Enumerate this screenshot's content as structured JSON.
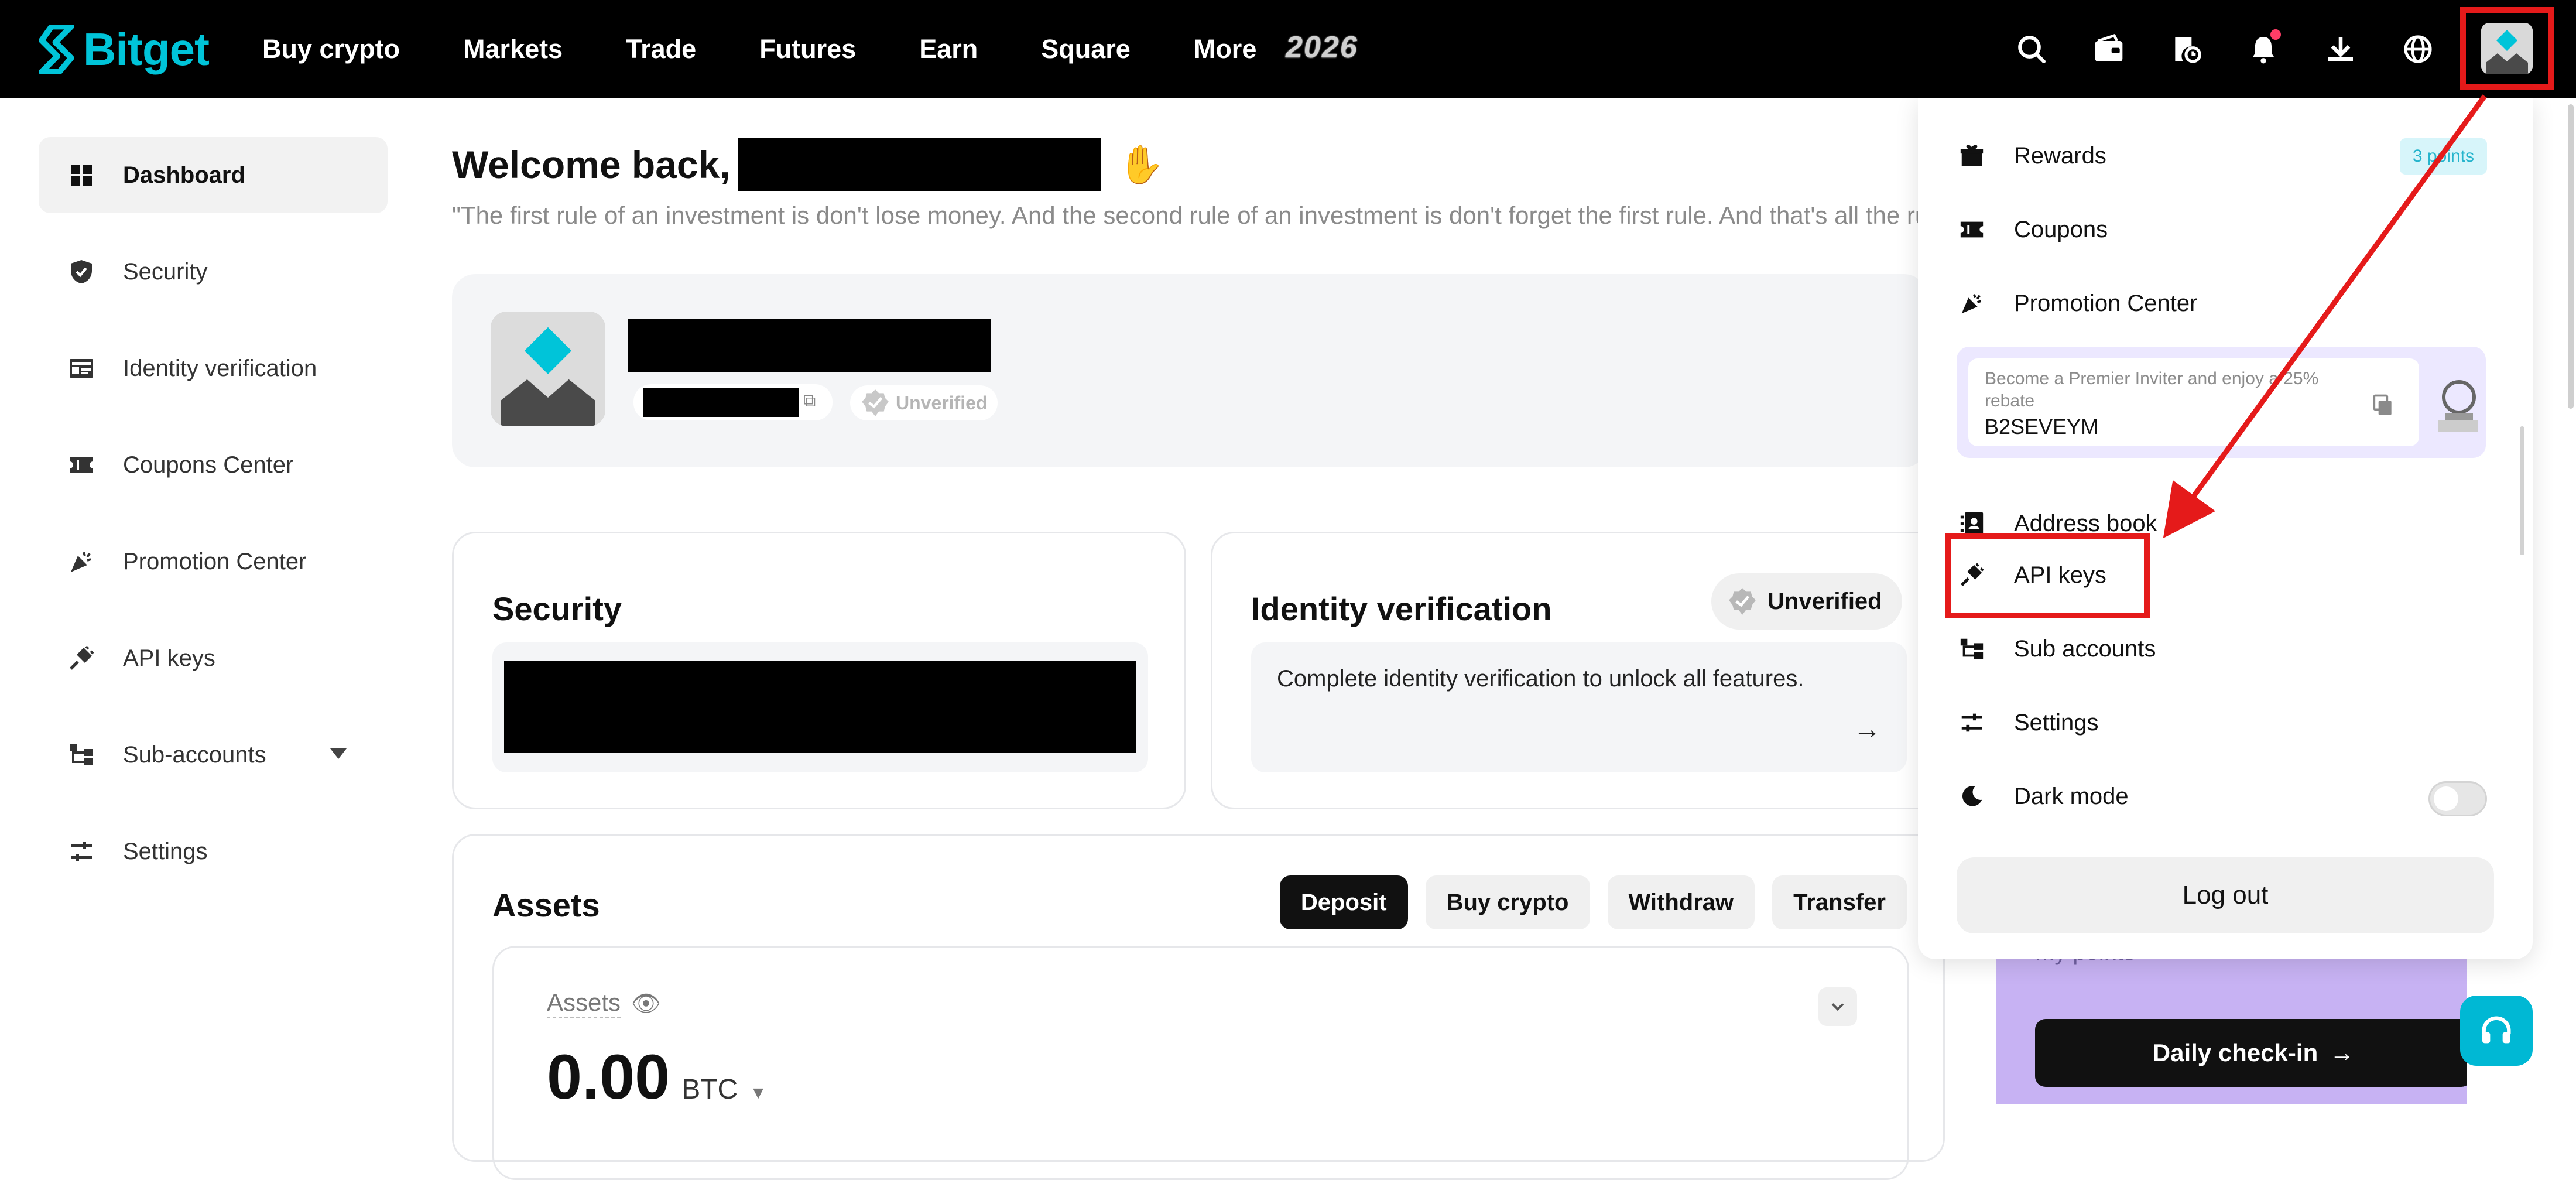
{
  "nav": {
    "logo_text": "Bitget",
    "links": [
      "Buy crypto",
      "Markets",
      "Trade",
      "Futures",
      "Earn",
      "Square",
      "More"
    ],
    "badge_text": "2026",
    "icons": [
      "search-icon",
      "wallet-icon",
      "orders-icon",
      "bell-icon",
      "download-icon",
      "globe-icon"
    ]
  },
  "sidebar": {
    "items": [
      {
        "label": "Dashboard",
        "icon": "grid-icon"
      },
      {
        "label": "Security",
        "icon": "shield-icon"
      },
      {
        "label": "Identity verification",
        "icon": "id-card-icon"
      },
      {
        "label": "Coupons Center",
        "icon": "ticket-icon"
      },
      {
        "label": "Promotion Center",
        "icon": "party-icon"
      },
      {
        "label": "API keys",
        "icon": "plug-icon"
      },
      {
        "label": "Sub-accounts",
        "icon": "sub-accounts-icon"
      },
      {
        "label": "Settings",
        "icon": "sliders-icon"
      }
    ]
  },
  "main": {
    "welcome": "Welcome back,",
    "quote": "\"The first rule of an investment is don't lose money. And the second rule of an investment is don't forget the first rule. And that's all the rules there are.\"",
    "profile": {
      "status": "Unverified"
    },
    "security": {
      "title": "Security"
    },
    "identity": {
      "title": "Identity verification",
      "status": "Unverified",
      "message": "Complete identity verification to unlock all features."
    },
    "assets": {
      "title": "Assets",
      "buttons": {
        "deposit": "Deposit",
        "buy": "Buy crypto",
        "withdraw": "Withdraw",
        "transfer": "Transfer"
      },
      "label": "Assets",
      "value": "0.00",
      "unit": "BTC"
    },
    "promo": {
      "muted_text": "My points",
      "checkin": "Daily check-in"
    }
  },
  "dropdown": {
    "rewards": "Rewards",
    "rewards_badge": "3 points",
    "coupons": "Coupons",
    "promotion": "Promotion Center",
    "invite_text": "Become a Premier Inviter and enjoy a 25% rebate",
    "invite_code": "B2SEVEYM",
    "address_book": "Address book",
    "api_keys": "API keys",
    "sub_accounts": "Sub accounts",
    "settings": "Settings",
    "dark_mode": "Dark mode",
    "logout": "Log out"
  },
  "colors": {
    "accent": "#00c4d9",
    "annotation_red": "#e51a1a",
    "promo_purple": "#c7b2f3"
  }
}
